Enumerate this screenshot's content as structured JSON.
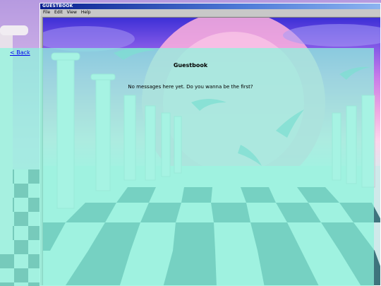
{
  "window": {
    "title": "GUESTBOOK",
    "menu": [
      "File",
      "Edit",
      "View",
      "Help"
    ]
  },
  "page": {
    "back_label": "< Back",
    "heading": "Guestbook",
    "empty_message": "No messages here yet. Do you wanna be the first?"
  },
  "colors": {
    "panel_overlay": "#8cf5dc",
    "link": "#0000ee",
    "titlebar": "#0a1f8f"
  }
}
